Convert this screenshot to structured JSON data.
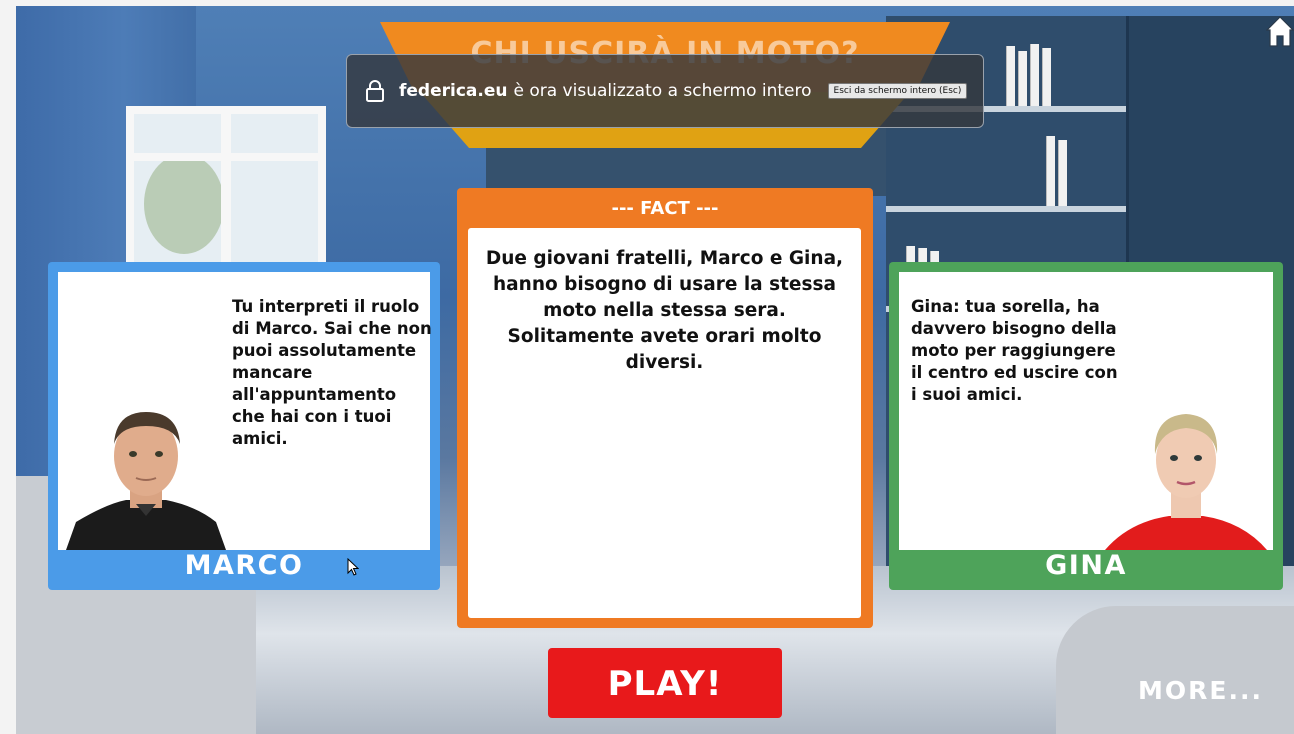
{
  "game": {
    "title": "CHI USCIRÀ IN MOTO?",
    "home_icon": "home-icon",
    "play_label": "PLAY!",
    "more_label": "MORE..."
  },
  "fullscreen_notice": {
    "site": "federica.eu",
    "message": "è ora visualizzato a schermo intero",
    "exit_label": "Esci da schermo intero (Esc)",
    "icon": "lock-icon"
  },
  "marco_card": {
    "description": "Tu interpreti il ruolo di Marco. Sai che non puoi assolutamente mancare all'appuntamento che hai con i tuoi amici.",
    "name": "MARCO",
    "color": "#4b9be8"
  },
  "fact_card": {
    "header": "--- FACT ---",
    "text": "Due giovani fratelli, Marco e Gina, hanno bisogno di usare la stessa moto nella stessa sera. Solitamente avete orari molto diversi.",
    "color": "#ef7a23"
  },
  "gina_card": {
    "description": "Gina: tua sorella, ha davvero bisogno della moto per raggiungere il centro ed uscire con i suoi amici.",
    "name": "GINA",
    "color": "#4ea35a"
  },
  "colors": {
    "play": "#e8191b"
  }
}
